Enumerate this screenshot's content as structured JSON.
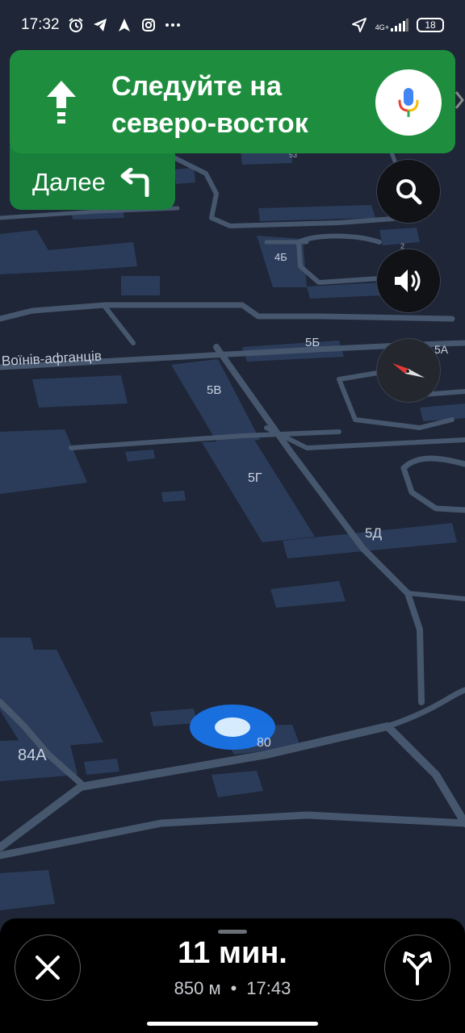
{
  "status_bar": {
    "time": "17:32",
    "left_icons": [
      "alarm-icon",
      "telegram-icon",
      "navigation-icon",
      "instagram-icon",
      "more-dots-icon"
    ],
    "network": "4G+",
    "battery": "18"
  },
  "navigation": {
    "instruction": "Следуйте на северо-восток",
    "maneuver_icon": "arrow-straight-icon",
    "next_label": "Далее",
    "next_maneuver_icon": "turn-left-icon"
  },
  "map": {
    "street_name": "Воїнів-афганців",
    "building_labels": [
      "4Б",
      "5Б",
      "5А",
      "5В",
      "5Г",
      "5Д",
      "84А",
      "80",
      "53",
      "2"
    ]
  },
  "controls": {
    "search_icon": "search-icon",
    "sound_icon": "volume-icon",
    "compass_icon": "compass-icon",
    "mic_icon": "mic-icon"
  },
  "trip": {
    "duration": "11 мин.",
    "distance": "850 м",
    "separator": "•",
    "arrival": "17:43"
  },
  "colors": {
    "banner": "#1e8e3e",
    "map_background": "#1e2637",
    "road": "#46566d",
    "building": "#2b3c5a",
    "location_dot": "#1a73e8"
  }
}
